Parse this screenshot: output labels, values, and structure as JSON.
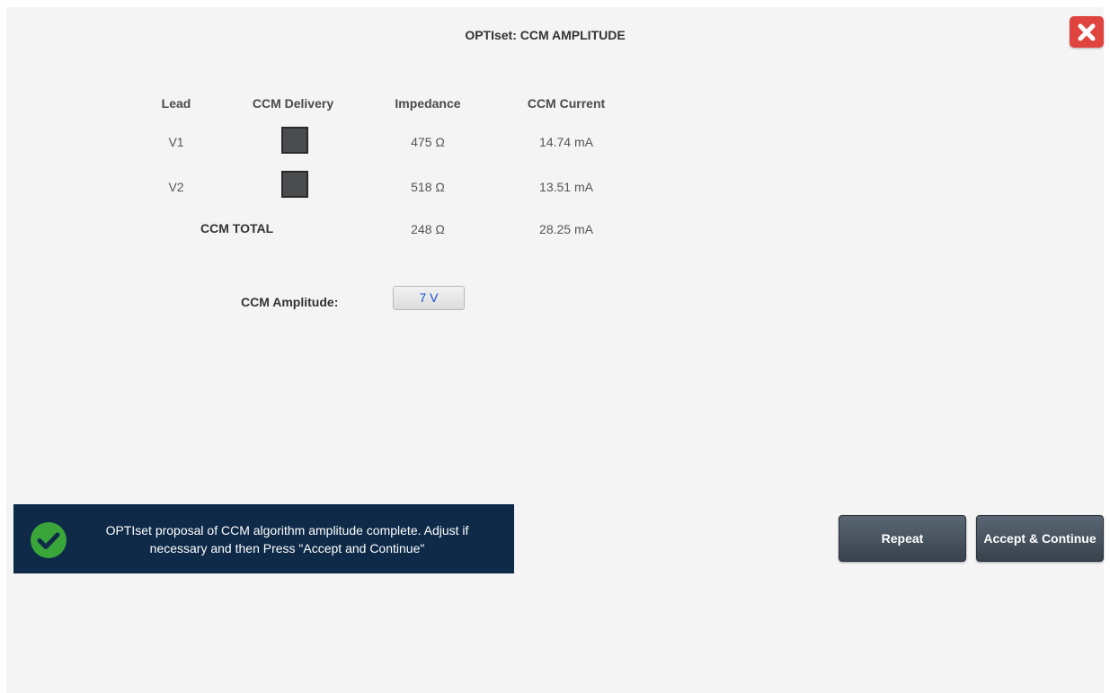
{
  "title": "OPTIset: CCM AMPLITUDE",
  "close_icon": "close-x-icon",
  "colors": {
    "close": "#e0443e",
    "status_bg": "#0e2a48",
    "check": "#3aa63a",
    "checkbox": "#4a4c4e",
    "amplitude_value": "#1a4ed8"
  },
  "table": {
    "headers": {
      "lead": "Lead",
      "delivery": "CCM Delivery",
      "impedance": "Impedance",
      "current": "CCM Current"
    },
    "rows": [
      {
        "lead": "V1",
        "delivery_checked": true,
        "impedance": "475 Ω",
        "current": "14.74 mA"
      },
      {
        "lead": "V2",
        "delivery_checked": true,
        "impedance": "518 Ω",
        "current": "13.51 mA"
      }
    ],
    "total": {
      "label": "CCM TOTAL",
      "impedance": "248 Ω",
      "current": "28.25 mA"
    }
  },
  "amplitude": {
    "label": "CCM Amplitude:",
    "value": "7 V"
  },
  "status": {
    "icon": "check-circle-icon",
    "line1": "OPTIset proposal of CCM algorithm amplitude complete. Adjust if",
    "line2": "necessary and then Press \"Accept and Continue\""
  },
  "buttons": {
    "repeat": "Repeat",
    "accept": "Accept & Continue"
  }
}
